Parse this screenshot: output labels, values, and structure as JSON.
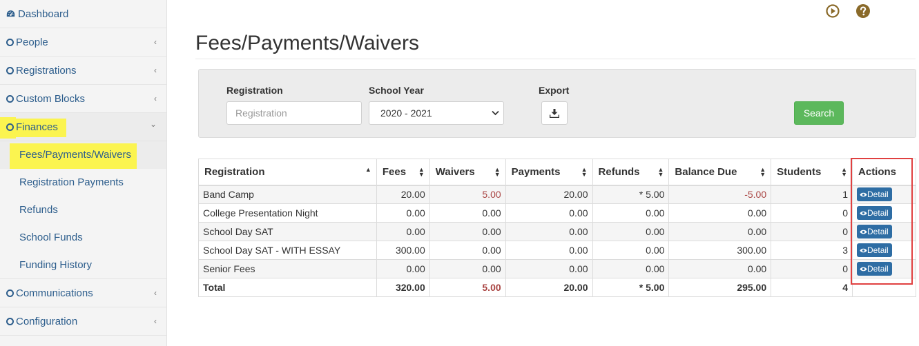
{
  "sidebar": {
    "dashboard": "Dashboard",
    "people": "People",
    "registrations": "Registrations",
    "custom_blocks": "Custom Blocks",
    "finances": "Finances",
    "finance_sub": [
      "Fees/Payments/Waivers",
      "Registration Payments",
      "Refunds",
      "School Funds",
      "Funding History"
    ],
    "communications": "Communications",
    "configuration": "Configuration",
    "chevron_collapsed": "‹",
    "chevron_expanded": "⌄"
  },
  "page": {
    "title": "Fees/Payments/Waivers"
  },
  "filters": {
    "registration_label": "Registration",
    "registration_placeholder": "Registration",
    "school_year_label": "School Year",
    "school_year_value": "2020 - 2021",
    "export_label": "Export",
    "search_label": "Search"
  },
  "table": {
    "headers": [
      "Registration",
      "Fees",
      "Waivers",
      "Payments",
      "Refunds",
      "Balance Due",
      "Students",
      "Actions"
    ],
    "rows": [
      [
        "Band Camp",
        "20.00",
        "5.00",
        "20.00",
        "* 5.00",
        "-5.00",
        "1"
      ],
      [
        "College Presentation Night",
        "0.00",
        "0.00",
        "0.00",
        "0.00",
        "0.00",
        "0"
      ],
      [
        "School Day SAT",
        "0.00",
        "0.00",
        "0.00",
        "0.00",
        "0.00",
        "0"
      ],
      [
        "School Day SAT - WITH ESSAY",
        "300.00",
        "0.00",
        "0.00",
        "0.00",
        "300.00",
        "3"
      ],
      [
        "Senior Fees",
        "0.00",
        "0.00",
        "0.00",
        "0.00",
        "0.00",
        "0"
      ]
    ],
    "total": [
      "Total",
      "320.00",
      "5.00",
      "20.00",
      "* 5.00",
      "295.00",
      "4"
    ],
    "detail_label": "Detail"
  },
  "colors": {
    "link": "#2c5d8c",
    "highlight": "#fbf450",
    "search_green": "#5cb85c",
    "detail_blue": "#2e6da4",
    "negative_red": "#a94442",
    "annotation_red": "#e04040",
    "top_icon_brown": "#8a6a2a"
  },
  "icons": {
    "dashboard": "dashboard-gauge-icon",
    "play": "play-circle-icon",
    "help": "question-circle-icon",
    "export": "download-icon",
    "detail": "eye-icon"
  }
}
